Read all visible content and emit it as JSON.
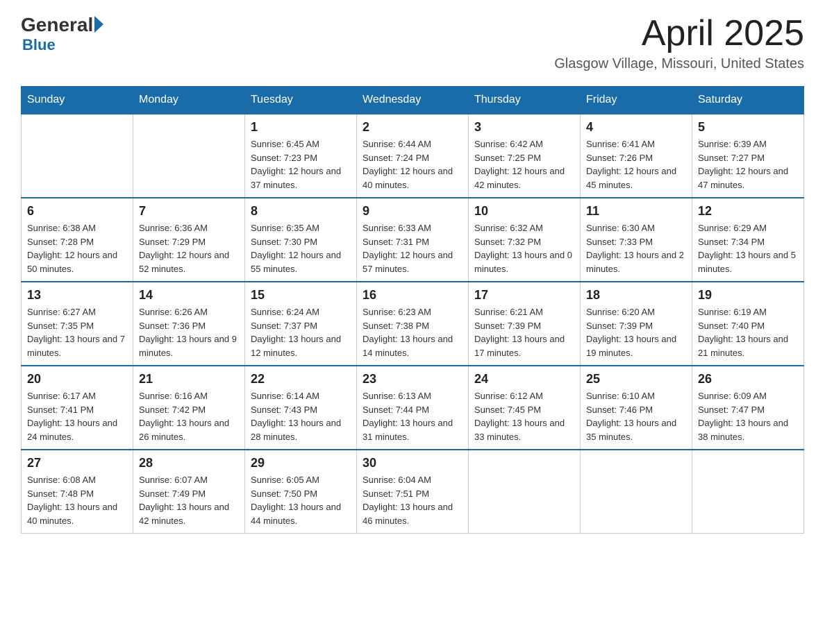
{
  "header": {
    "logo_general": "General",
    "logo_blue": "Blue",
    "month": "April 2025",
    "location": "Glasgow Village, Missouri, United States"
  },
  "days_of_week": [
    "Sunday",
    "Monday",
    "Tuesday",
    "Wednesday",
    "Thursday",
    "Friday",
    "Saturday"
  ],
  "weeks": [
    [
      {
        "day": "",
        "sunrise": "",
        "sunset": "",
        "daylight": ""
      },
      {
        "day": "",
        "sunrise": "",
        "sunset": "",
        "daylight": ""
      },
      {
        "day": "1",
        "sunrise": "Sunrise: 6:45 AM",
        "sunset": "Sunset: 7:23 PM",
        "daylight": "Daylight: 12 hours and 37 minutes."
      },
      {
        "day": "2",
        "sunrise": "Sunrise: 6:44 AM",
        "sunset": "Sunset: 7:24 PM",
        "daylight": "Daylight: 12 hours and 40 minutes."
      },
      {
        "day": "3",
        "sunrise": "Sunrise: 6:42 AM",
        "sunset": "Sunset: 7:25 PM",
        "daylight": "Daylight: 12 hours and 42 minutes."
      },
      {
        "day": "4",
        "sunrise": "Sunrise: 6:41 AM",
        "sunset": "Sunset: 7:26 PM",
        "daylight": "Daylight: 12 hours and 45 minutes."
      },
      {
        "day": "5",
        "sunrise": "Sunrise: 6:39 AM",
        "sunset": "Sunset: 7:27 PM",
        "daylight": "Daylight: 12 hours and 47 minutes."
      }
    ],
    [
      {
        "day": "6",
        "sunrise": "Sunrise: 6:38 AM",
        "sunset": "Sunset: 7:28 PM",
        "daylight": "Daylight: 12 hours and 50 minutes."
      },
      {
        "day": "7",
        "sunrise": "Sunrise: 6:36 AM",
        "sunset": "Sunset: 7:29 PM",
        "daylight": "Daylight: 12 hours and 52 minutes."
      },
      {
        "day": "8",
        "sunrise": "Sunrise: 6:35 AM",
        "sunset": "Sunset: 7:30 PM",
        "daylight": "Daylight: 12 hours and 55 minutes."
      },
      {
        "day": "9",
        "sunrise": "Sunrise: 6:33 AM",
        "sunset": "Sunset: 7:31 PM",
        "daylight": "Daylight: 12 hours and 57 minutes."
      },
      {
        "day": "10",
        "sunrise": "Sunrise: 6:32 AM",
        "sunset": "Sunset: 7:32 PM",
        "daylight": "Daylight: 13 hours and 0 minutes."
      },
      {
        "day": "11",
        "sunrise": "Sunrise: 6:30 AM",
        "sunset": "Sunset: 7:33 PM",
        "daylight": "Daylight: 13 hours and 2 minutes."
      },
      {
        "day": "12",
        "sunrise": "Sunrise: 6:29 AM",
        "sunset": "Sunset: 7:34 PM",
        "daylight": "Daylight: 13 hours and 5 minutes."
      }
    ],
    [
      {
        "day": "13",
        "sunrise": "Sunrise: 6:27 AM",
        "sunset": "Sunset: 7:35 PM",
        "daylight": "Daylight: 13 hours and 7 minutes."
      },
      {
        "day": "14",
        "sunrise": "Sunrise: 6:26 AM",
        "sunset": "Sunset: 7:36 PM",
        "daylight": "Daylight: 13 hours and 9 minutes."
      },
      {
        "day": "15",
        "sunrise": "Sunrise: 6:24 AM",
        "sunset": "Sunset: 7:37 PM",
        "daylight": "Daylight: 13 hours and 12 minutes."
      },
      {
        "day": "16",
        "sunrise": "Sunrise: 6:23 AM",
        "sunset": "Sunset: 7:38 PM",
        "daylight": "Daylight: 13 hours and 14 minutes."
      },
      {
        "day": "17",
        "sunrise": "Sunrise: 6:21 AM",
        "sunset": "Sunset: 7:39 PM",
        "daylight": "Daylight: 13 hours and 17 minutes."
      },
      {
        "day": "18",
        "sunrise": "Sunrise: 6:20 AM",
        "sunset": "Sunset: 7:39 PM",
        "daylight": "Daylight: 13 hours and 19 minutes."
      },
      {
        "day": "19",
        "sunrise": "Sunrise: 6:19 AM",
        "sunset": "Sunset: 7:40 PM",
        "daylight": "Daylight: 13 hours and 21 minutes."
      }
    ],
    [
      {
        "day": "20",
        "sunrise": "Sunrise: 6:17 AM",
        "sunset": "Sunset: 7:41 PM",
        "daylight": "Daylight: 13 hours and 24 minutes."
      },
      {
        "day": "21",
        "sunrise": "Sunrise: 6:16 AM",
        "sunset": "Sunset: 7:42 PM",
        "daylight": "Daylight: 13 hours and 26 minutes."
      },
      {
        "day": "22",
        "sunrise": "Sunrise: 6:14 AM",
        "sunset": "Sunset: 7:43 PM",
        "daylight": "Daylight: 13 hours and 28 minutes."
      },
      {
        "day": "23",
        "sunrise": "Sunrise: 6:13 AM",
        "sunset": "Sunset: 7:44 PM",
        "daylight": "Daylight: 13 hours and 31 minutes."
      },
      {
        "day": "24",
        "sunrise": "Sunrise: 6:12 AM",
        "sunset": "Sunset: 7:45 PM",
        "daylight": "Daylight: 13 hours and 33 minutes."
      },
      {
        "day": "25",
        "sunrise": "Sunrise: 6:10 AM",
        "sunset": "Sunset: 7:46 PM",
        "daylight": "Daylight: 13 hours and 35 minutes."
      },
      {
        "day": "26",
        "sunrise": "Sunrise: 6:09 AM",
        "sunset": "Sunset: 7:47 PM",
        "daylight": "Daylight: 13 hours and 38 minutes."
      }
    ],
    [
      {
        "day": "27",
        "sunrise": "Sunrise: 6:08 AM",
        "sunset": "Sunset: 7:48 PM",
        "daylight": "Daylight: 13 hours and 40 minutes."
      },
      {
        "day": "28",
        "sunrise": "Sunrise: 6:07 AM",
        "sunset": "Sunset: 7:49 PM",
        "daylight": "Daylight: 13 hours and 42 minutes."
      },
      {
        "day": "29",
        "sunrise": "Sunrise: 6:05 AM",
        "sunset": "Sunset: 7:50 PM",
        "daylight": "Daylight: 13 hours and 44 minutes."
      },
      {
        "day": "30",
        "sunrise": "Sunrise: 6:04 AM",
        "sunset": "Sunset: 7:51 PM",
        "daylight": "Daylight: 13 hours and 46 minutes."
      },
      {
        "day": "",
        "sunrise": "",
        "sunset": "",
        "daylight": ""
      },
      {
        "day": "",
        "sunrise": "",
        "sunset": "",
        "daylight": ""
      },
      {
        "day": "",
        "sunrise": "",
        "sunset": "",
        "daylight": ""
      }
    ]
  ]
}
